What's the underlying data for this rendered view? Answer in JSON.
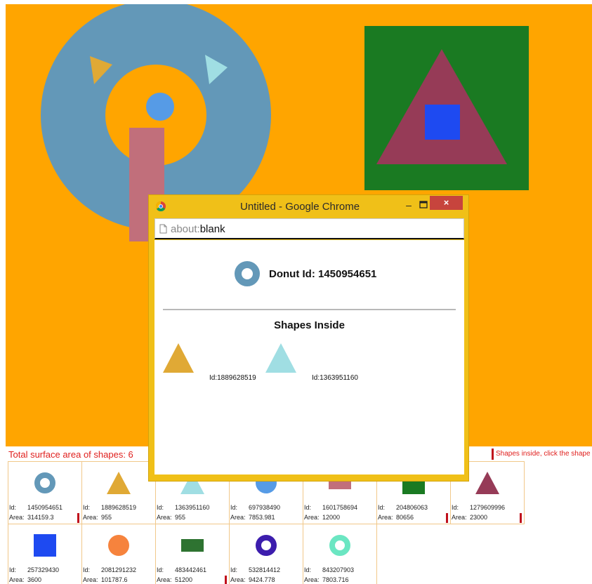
{
  "canvas": {
    "background": "#FFA500",
    "shapes": [
      {
        "kind": "donut",
        "color": "#6398B8"
      },
      {
        "kind": "triangle",
        "color": "#E0A935"
      },
      {
        "kind": "triangle",
        "color": "#A0DEE3"
      },
      {
        "kind": "circle",
        "color": "#569BE6"
      },
      {
        "kind": "rectangle",
        "color": "#C16F7B"
      },
      {
        "kind": "square",
        "color": "#1A7A22"
      },
      {
        "kind": "triangle",
        "color": "#963B57"
      },
      {
        "kind": "square",
        "color": "#1E4AF1"
      }
    ]
  },
  "status": {
    "total_label": "Total surface area of shapes: 6",
    "hint": "Shapes inside, click the shape"
  },
  "cards": [
    {
      "id_label": "Id:",
      "id": "1450954651",
      "area_label": "Area:",
      "area": "314159.3",
      "shape": "donut",
      "color": "#6398B8",
      "marked": true
    },
    {
      "id_label": "Id:",
      "id": "1889628519",
      "area_label": "Area:",
      "area": "955",
      "shape": "triangle",
      "color": "#E0A935",
      "marked": false
    },
    {
      "id_label": "Id:",
      "id": "1363951160",
      "area_label": "Area:",
      "area": "955",
      "shape": "triangle",
      "color": "#A0DEE3",
      "marked": false
    },
    {
      "id_label": "Id:",
      "id": "697938490",
      "area_label": "Area:",
      "area": "7853.981",
      "shape": "circle",
      "color": "#569BE6",
      "marked": false
    },
    {
      "id_label": "Id:",
      "id": "1601758694",
      "area_label": "Area:",
      "area": "12000",
      "shape": "rectangle",
      "color": "#C16F7B",
      "marked": false
    },
    {
      "id_label": "Id:",
      "id": "204806063",
      "area_label": "Area:",
      "area": "80656",
      "shape": "square",
      "color": "#1A7A22",
      "marked": true
    },
    {
      "id_label": "Id:",
      "id": "1279609996",
      "area_label": "Area:",
      "area": "23000",
      "shape": "triangle",
      "color": "#963B57",
      "marked": true
    },
    {
      "id_label": "Id:",
      "id": "257329430",
      "area_label": "Area:",
      "area": "3600",
      "shape": "square",
      "color": "#1E4AF1",
      "marked": false
    },
    {
      "id_label": "Id:",
      "id": "2081291232",
      "area_label": "Area:",
      "area": "101787.6",
      "shape": "circle",
      "color": "#F6833D",
      "marked": false
    },
    {
      "id_label": "Id:",
      "id": "483442461",
      "area_label": "Area:",
      "area": "51200",
      "shape": "rectangle",
      "color": "#2E7331",
      "marked": true
    },
    {
      "id_label": "Id:",
      "id": "532814412",
      "area_label": "Area:",
      "area": "9424.778",
      "shape": "donut",
      "color": "#3C1DAD",
      "marked": false
    },
    {
      "id_label": "Id:",
      "id": "843207903",
      "area_label": "Area:",
      "area": "7803.716",
      "shape": "donut",
      "color": "#6BE6C2",
      "marked": false
    }
  ],
  "popup": {
    "title": "Untitled - Google Chrome",
    "minimize_glyph": "–",
    "close_glyph": "×",
    "url_scheme": "about:",
    "url_path": "blank",
    "heading": "Donut  Id: 1450954651",
    "heading_shape_color": "#6398B8",
    "subheading": "Shapes Inside",
    "inside": [
      {
        "shape": "triangle",
        "color": "#E0A935",
        "id_text": "Id:1889628519"
      },
      {
        "shape": "triangle",
        "color": "#A0DEE3",
        "id_text": "Id:1363951160"
      }
    ],
    "frame_color": "#F0C018",
    "close_color": "#C7443D"
  }
}
